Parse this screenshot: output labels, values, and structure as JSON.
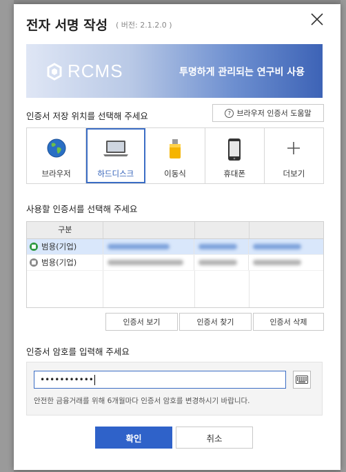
{
  "dialog": {
    "title": "전자 서명 작성",
    "version": "( 버전: 2.1.2.0 )"
  },
  "banner": {
    "logo_text": "RCMS",
    "slogan": "투명하게 관리되는 연구비 사용"
  },
  "storage": {
    "heading": "인증서 저장 위치를 선택해 주세요",
    "help_label": "브라우저 인증서 도움말",
    "items": [
      {
        "label": "브라우저",
        "icon": "globe-icon",
        "selected": false
      },
      {
        "label": "하드디스크",
        "icon": "laptop-icon",
        "selected": true
      },
      {
        "label": "이동식",
        "icon": "usb-drive-icon",
        "selected": false
      },
      {
        "label": "휴대폰",
        "icon": "phone-icon",
        "selected": false
      },
      {
        "label": "더보기",
        "icon": "plus-icon",
        "selected": false
      }
    ]
  },
  "certs": {
    "heading": "사용할 인증서를 선택해 주세요",
    "columns": [
      "구분"
    ],
    "rows": [
      {
        "kind": "범용(기업)",
        "icon": "green-cert-icon",
        "selected": true
      },
      {
        "kind": "범용(기업)",
        "icon": "gray-cert-icon",
        "selected": false
      }
    ],
    "buttons": {
      "view": "인증서 보기",
      "find": "인증서 찾기",
      "delete": "인증서 삭제"
    }
  },
  "password": {
    "heading": "인증서 암호를 입력해 주세요",
    "value": "•••••••••••",
    "hint": "안전한 금융거래를 위해 6개월마다 인증서 암호를 변경하시기 바랍니다."
  },
  "footer": {
    "confirm": "확인",
    "cancel": "취소"
  },
  "colors": {
    "primary": "#2f62c9",
    "selected_outline": "#3a6cc4",
    "row_selected": "#d9e7fb"
  }
}
